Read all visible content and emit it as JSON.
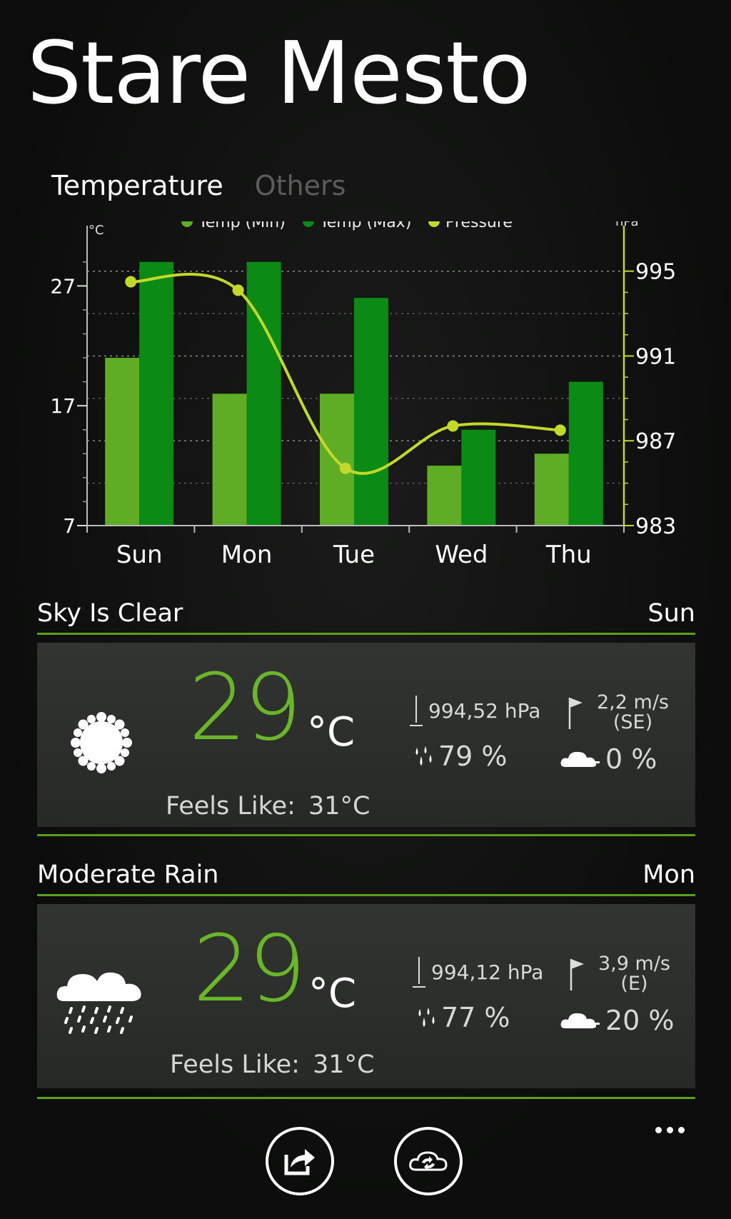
{
  "city": "Stare Mesto",
  "pivot": {
    "active": "Temperature",
    "inactive": "Others"
  },
  "colors": {
    "min": "#5fad24",
    "max": "#0b8a16",
    "pressure": "#c3d92a",
    "accent": "#6ab52a"
  },
  "chart_data": {
    "type": "bar",
    "categories": [
      "Sun",
      "Mon",
      "Tue",
      "Wed",
      "Thu"
    ],
    "series": [
      {
        "name": "Temp (Min)",
        "type": "bar",
        "axis": "left",
        "values": [
          21,
          18,
          18,
          12,
          13
        ]
      },
      {
        "name": "Temp (Max)",
        "type": "bar",
        "axis": "left",
        "values": [
          29,
          29,
          26,
          15,
          19
        ]
      },
      {
        "name": "Pressure",
        "type": "line",
        "axis": "right",
        "values": [
          994.5,
          994.1,
          985.7,
          987.7,
          987.5
        ]
      }
    ],
    "yleft": {
      "label": "°C",
      "ticks": [
        7,
        17,
        27
      ],
      "range": [
        7,
        30
      ]
    },
    "yright": {
      "label": "hPa",
      "ticks": [
        983,
        987,
        991,
        995
      ],
      "range": [
        983,
        996
      ]
    },
    "legend_position": "top",
    "grid": true
  },
  "days": [
    {
      "condition": "Sky Is Clear",
      "day": "Sun",
      "icon": "sun-icon",
      "temp": "29",
      "unit": "°C",
      "feels_label": "Feels Like:",
      "feels_value": "31°C",
      "pressure": "994,52 hPa",
      "wind_speed": "2,2 m/s",
      "wind_dir": "(SE)",
      "humidity": "79 %",
      "clouds": "0 %"
    },
    {
      "condition": "Moderate Rain",
      "day": "Mon",
      "icon": "rain-cloud-icon",
      "temp": "29",
      "unit": "°C",
      "feels_label": "Feels Like:",
      "feels_value": "31°C",
      "pressure": "994,12 hPa",
      "wind_speed": "3,9 m/s",
      "wind_dir": "(E)",
      "humidity": "77 %",
      "clouds": "20 %"
    }
  ],
  "appbar": {
    "share_icon": "share-icon",
    "refresh_icon": "cloud-refresh-icon",
    "more_icon": "more-icon"
  }
}
